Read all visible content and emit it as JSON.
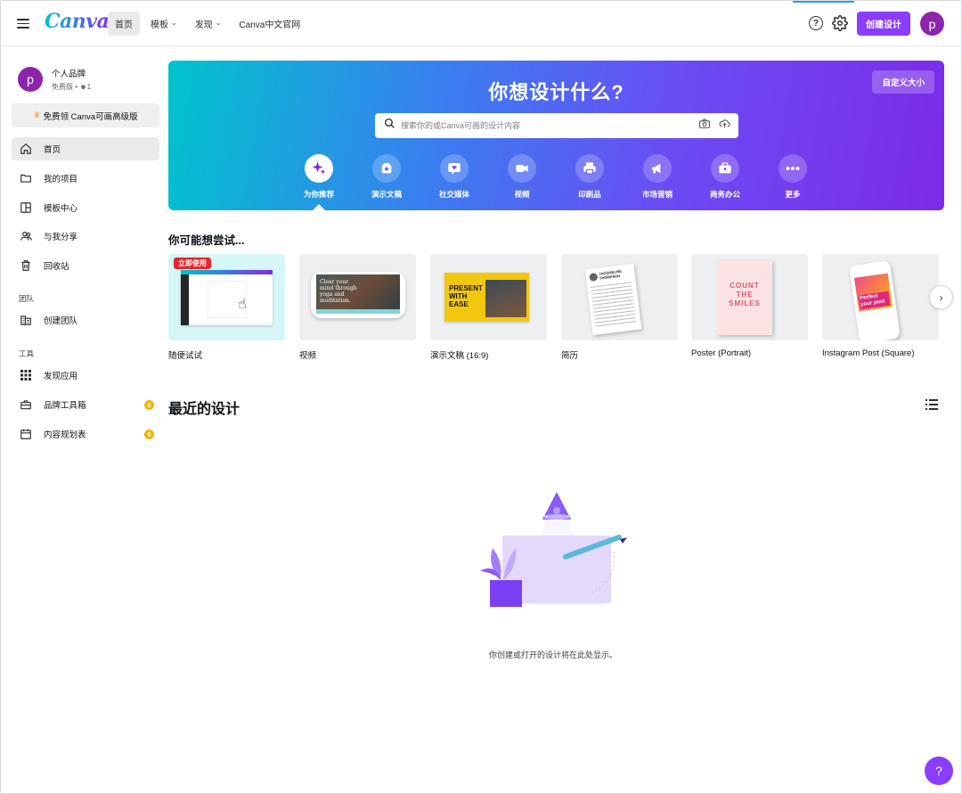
{
  "header": {
    "logo": "Canva",
    "nav": [
      {
        "label": "首页",
        "has_menu": false
      },
      {
        "label": "模板",
        "has_menu": true
      },
      {
        "label": "发现",
        "has_menu": true
      },
      {
        "label": "Canva中文官网",
        "has_menu": false
      }
    ],
    "help_icon": "?",
    "create_label": "创建设计",
    "avatar_letter": "p"
  },
  "sidebar": {
    "team_name": "个人品牌",
    "team_plan": "免费版",
    "team_members": "1",
    "avatar_letter": "p",
    "promo_label": "免费领 Canva可画高级版",
    "items": [
      {
        "label": "首页",
        "icon": "home-icon"
      },
      {
        "label": "我的项目",
        "icon": "folder-icon"
      },
      {
        "label": "模板中心",
        "icon": "template-icon"
      },
      {
        "label": "与我分享",
        "icon": "shared-users-icon"
      },
      {
        "label": "回收站",
        "icon": "trash-icon"
      }
    ],
    "section_team": "团队",
    "team_items": [
      {
        "label": "创建团队",
        "icon": "building-icon"
      }
    ],
    "section_tools": "工具",
    "tool_items": [
      {
        "label": "发现应用",
        "icon": "apps-grid-icon"
      },
      {
        "label": "品牌工具箱",
        "icon": "brand-kit-icon",
        "premium": true
      },
      {
        "label": "内容规划表",
        "icon": "calendar-icon",
        "premium": true
      }
    ]
  },
  "hero": {
    "title": "你想设计什么?",
    "custom_size": "自定义大小",
    "search_placeholder": "搜索你的或Canva可画的设计内容",
    "categories": [
      {
        "label": "为你推荐",
        "icon": "sparkle-icon"
      },
      {
        "label": "演示文稿",
        "icon": "presentation-icon"
      },
      {
        "label": "社交媒体",
        "icon": "heart-bubble-icon"
      },
      {
        "label": "视频",
        "icon": "video-icon"
      },
      {
        "label": "印刷品",
        "icon": "printer-icon"
      },
      {
        "label": "市场营销",
        "icon": "megaphone-icon"
      },
      {
        "label": "商务办公",
        "icon": "briefcase-icon"
      },
      {
        "label": "更多",
        "icon": "more-icon"
      }
    ]
  },
  "suggestions": {
    "title": "你可能想尝试...",
    "badge": "立即使用",
    "cards": [
      {
        "label": "随便试试"
      },
      {
        "label": "视频",
        "thumb_text": "Clear your mind through yoga and meditation."
      },
      {
        "label": "演示文稿 (16:9)",
        "thumb_text": "PRESENT WITH EASE"
      },
      {
        "label": "简历",
        "thumb_text": "JACQUELINE THOMPSON"
      },
      {
        "label": "Poster (Portrait)",
        "thumb_text": "COUNT THE SMILES"
      },
      {
        "label": "Instagram Post (Square)",
        "thumb_text": "Perfect your post"
      }
    ]
  },
  "recent": {
    "title": "最近的设计",
    "empty_text": "你创建或打开的设计将在此处显示。"
  },
  "colors": {
    "accent": "#8b3dff",
    "brand_avatar": "#8e24aa",
    "badge_red": "#e4262c",
    "premium_gold": "#f5b301"
  }
}
